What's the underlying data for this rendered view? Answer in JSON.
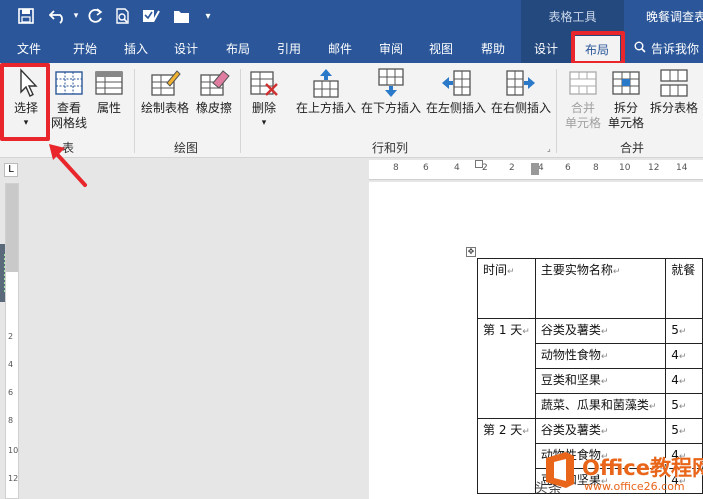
{
  "titlebar": {
    "contextual_tools": "表格工具",
    "document_title": "晚餐调查表"
  },
  "tabs": [
    "文件",
    "开始",
    "插入",
    "设计",
    "布局",
    "引用",
    "邮件",
    "审阅",
    "视图",
    "帮助",
    "设计",
    "布局"
  ],
  "active_tab": "布局",
  "tell_me": "告诉我你",
  "ribbon": {
    "select": "选择",
    "view_gridlines_1": "查看",
    "view_gridlines_2": "网格线",
    "properties": "属性",
    "draw_table": "绘制表格",
    "eraser": "橡皮擦",
    "delete": "删除",
    "insert_above": "在上方插入",
    "insert_below": "在下方插入",
    "insert_left": "在左侧插入",
    "insert_right": "在右侧插入",
    "merge_cells_1": "合并",
    "merge_cells_2": "单元格",
    "split_cells_1": "拆分",
    "split_cells_2": "单元格",
    "split_table": "拆分表格",
    "groups": {
      "table": "表",
      "draw": "绘图",
      "rows_cols": "行和列",
      "merge": "合并"
    }
  },
  "ruler": {
    "top_numbers": [
      "8",
      "6",
      "4",
      "2",
      "2",
      "4",
      "6",
      "8",
      "10",
      "12",
      "14"
    ],
    "left_numbers": [
      "2",
      "4",
      "6",
      "8",
      "10",
      "12"
    ]
  },
  "table": {
    "header": [
      "时间",
      "主要实物名称",
      "就餐"
    ],
    "rows": [
      [
        "第 1 天",
        "谷类及薯类",
        "5"
      ],
      [
        "",
        "动物性食物",
        "4"
      ],
      [
        "",
        "豆类和坚果",
        "4"
      ],
      [
        "",
        "蔬菜、瓜果和菌藻类",
        "5"
      ],
      [
        "第 2 天",
        "谷类及薯类",
        "5"
      ],
      [
        "",
        "动物性食物",
        "4"
      ],
      [
        "",
        "豆类和坚果",
        "4"
      ]
    ]
  },
  "watermark": {
    "name": "Office教程网",
    "url": "www.office26.com",
    "extra": "头条"
  },
  "colors": {
    "accent": "#2b579a",
    "highlight": "#e8262b"
  }
}
